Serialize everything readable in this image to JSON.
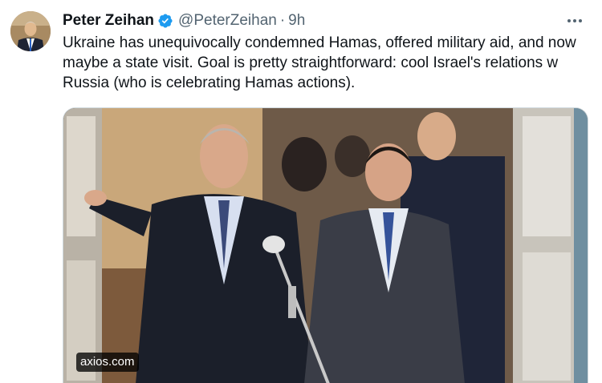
{
  "author": {
    "name": "Peter Zeihan",
    "handle": "@PeterZeihan",
    "separator": "·",
    "time": "9h"
  },
  "icons": {
    "verified": "verified-badge-icon",
    "more": "more-options-icon"
  },
  "tweet": {
    "text": "Ukraine has unequivocally condemned Hamas, offered military aid, and now maybe a state visit. Goal is pretty straightforward: cool Israel's relations w Russia (who is celebrating Hamas actions)."
  },
  "card": {
    "domain": "axios.com"
  },
  "colors": {
    "verified": "#1d9bf0",
    "secondary_text": "#536471",
    "primary_text": "#0f1419"
  }
}
